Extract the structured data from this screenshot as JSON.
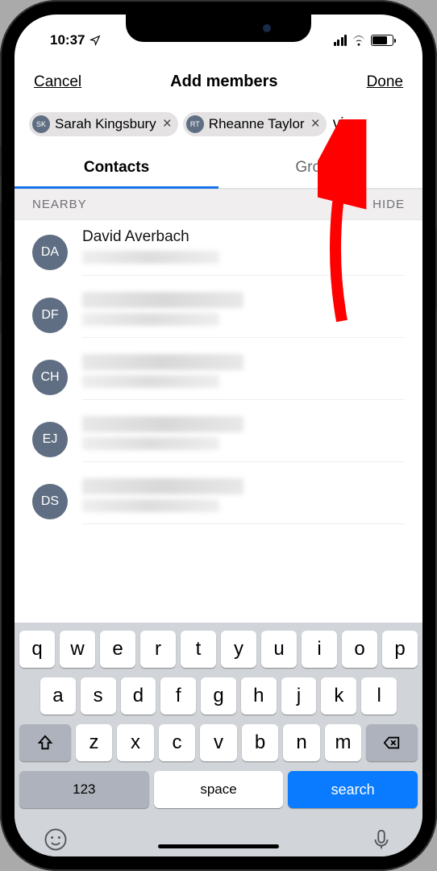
{
  "status": {
    "time": "10:37"
  },
  "nav": {
    "cancel": "Cancel",
    "title": "Add members",
    "done": "Done"
  },
  "chips": [
    {
      "initials": "SK",
      "name": "Sarah Kingsbury"
    },
    {
      "initials": "RT",
      "name": "Rheanne Taylor"
    }
  ],
  "trailing_input": "vi",
  "tabs": {
    "contacts": "Contacts",
    "groups": "Groups"
  },
  "section": {
    "label": "NEARBY",
    "action": "HIDE"
  },
  "contacts": [
    {
      "initials": "DA",
      "name": "David Averbach",
      "blurred": false
    },
    {
      "initials": "DF",
      "blurred": true
    },
    {
      "initials": "CH",
      "blurred": true
    },
    {
      "initials": "EJ",
      "blurred": true
    },
    {
      "initials": "DS",
      "blurred": true
    }
  ],
  "keyboard": {
    "row1": [
      "q",
      "w",
      "e",
      "r",
      "t",
      "y",
      "u",
      "i",
      "o",
      "p"
    ],
    "row2": [
      "a",
      "s",
      "d",
      "f",
      "g",
      "h",
      "j",
      "k",
      "l"
    ],
    "row3": [
      "z",
      "x",
      "c",
      "v",
      "b",
      "n",
      "m"
    ],
    "numbers": "123",
    "space": "space",
    "action": "search"
  }
}
